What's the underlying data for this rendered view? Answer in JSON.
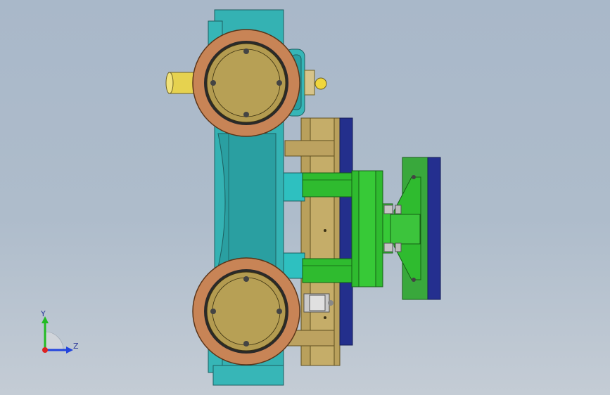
{
  "viewport": {
    "background_top": "#a9b8c9",
    "background_bottom": "#c4ccd5"
  },
  "model": {
    "colors": {
      "frame_teal": "#33b0b2",
      "wheel_rim": "#c88456",
      "wheel_hub": "#b39b50",
      "shaft_yellow": "#e6d050",
      "plate_tan": "#b79d5a",
      "plate_blue": "#232f8c",
      "block_green": "#2fbb2f",
      "bolt_grey": "#c5c5c5"
    },
    "icons": [
      "wheel-assembly-icon",
      "bolt-icon",
      "cylinder-icon"
    ]
  },
  "triad": {
    "y_label": "Y",
    "z_label": "Z",
    "colors": {
      "y": "#22bb22",
      "z": "#2244dd",
      "x": "#dd2222"
    }
  }
}
